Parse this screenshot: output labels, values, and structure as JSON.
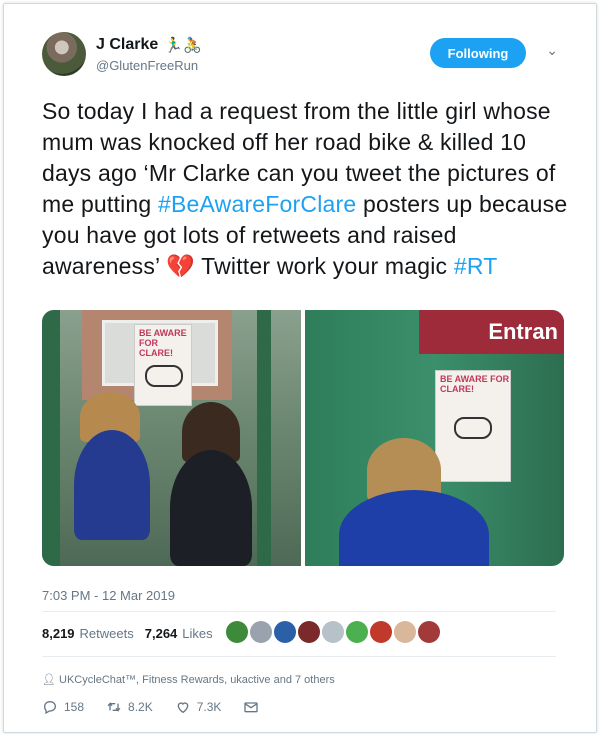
{
  "user": {
    "name": "J Clarke",
    "name_emojis": "🏃‍♂️🚴",
    "handle": "@GlutenFreeRun"
  },
  "follow_button": {
    "label": "Following"
  },
  "tweet": {
    "text_1": "So today I had a request from the little girl whose mum was knocked off her road bike & killed 10 days ago ‘Mr Clarke can you tweet the pictures of me putting ",
    "hashtag_1": "#BeAwareForClare",
    "text_2": " posters up because you have got lots of retweets and raised awareness’ ",
    "heart": "💔",
    "text_3": " Twitter work your magic ",
    "hashtag_2": "#RT"
  },
  "photos": {
    "poster_text": "BE AWARE FOR CLARE!",
    "sign_text": "Entran"
  },
  "timestamp": "7:03 PM - 12 Mar 2019",
  "stats": {
    "retweets_count": "8,219",
    "retweets_label": "Retweets",
    "likes_count": "7,264",
    "likes_label": "Likes"
  },
  "liked_by": "UKCycleChat™, Fitness Rewards, ukactive and 7 others",
  "actions": {
    "replies": "158",
    "retweets": "8.2K",
    "likes": "7.3K"
  },
  "colors": {
    "accent": "#1da1f2",
    "text": "#14171a",
    "muted": "#657786"
  }
}
